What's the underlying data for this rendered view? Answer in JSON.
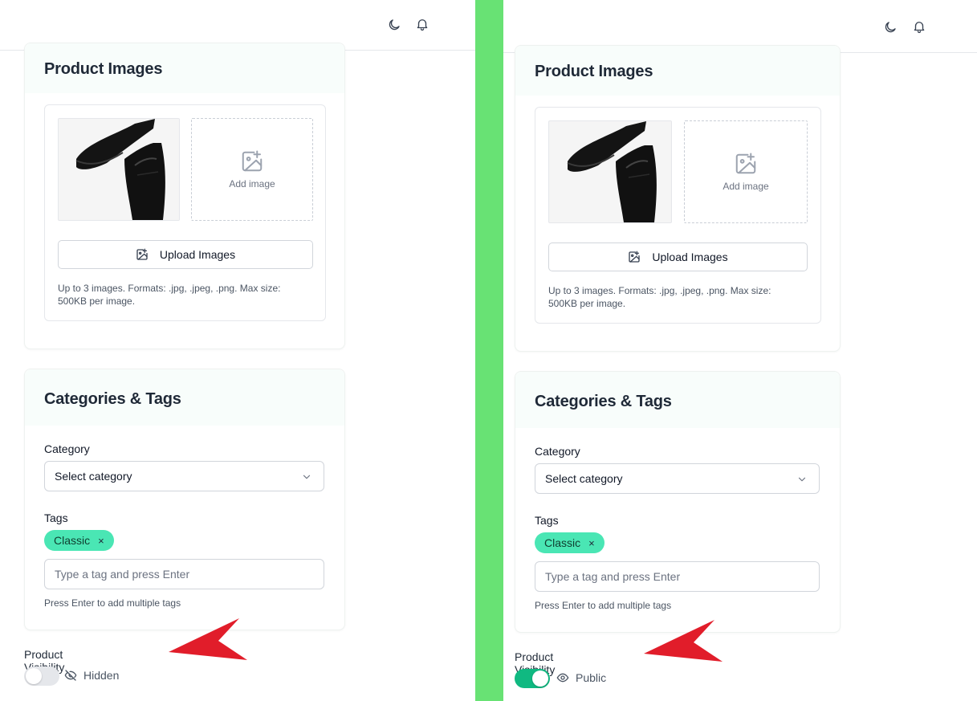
{
  "colors": {
    "divider": "#68e274",
    "tag_bg": "#4ae6b4",
    "toggle_on": "#10b981",
    "toggle_off": "#e5e7eb",
    "arrow": "#e11d2a"
  },
  "panels": [
    {
      "header": {
        "icons": [
          "moon-icon",
          "bell-icon"
        ]
      },
      "images_card": {
        "title": "Product Images",
        "add_image_label": "Add image",
        "upload_button": "Upload Images",
        "help": "Up to 3 images. Formats: .jpg, .jpeg, .png. Max size: 500KB per image."
      },
      "categories_card": {
        "title": "Categories & Tags",
        "category_label": "Category",
        "category_value": "Select category",
        "tags_label": "Tags",
        "tags": [
          "Classic"
        ],
        "tag_remove": "×",
        "tag_placeholder": "Type a tag and press Enter",
        "tag_hint": "Press Enter to add multiple tags"
      },
      "visibility": {
        "label": "Product Visibility",
        "state": "Hidden",
        "enabled": false
      }
    },
    {
      "header": {
        "icons": [
          "moon-icon",
          "bell-icon"
        ]
      },
      "images_card": {
        "title": "Product Images",
        "add_image_label": "Add image",
        "upload_button": "Upload Images",
        "help": "Up to 3 images. Formats: .jpg, .jpeg, .png. Max size: 500KB per image."
      },
      "categories_card": {
        "title": "Categories & Tags",
        "category_label": "Category",
        "category_value": "Select category",
        "tags_label": "Tags",
        "tags": [
          "Classic"
        ],
        "tag_remove": "×",
        "tag_placeholder": "Type a tag and press Enter",
        "tag_hint": "Press Enter to add multiple tags"
      },
      "visibility": {
        "label": "Product Visibility",
        "state": "Public",
        "enabled": true
      }
    }
  ]
}
